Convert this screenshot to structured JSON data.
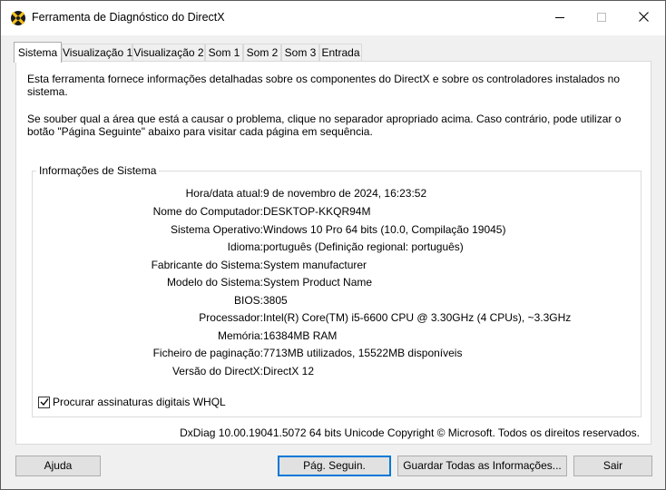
{
  "window": {
    "title": "Ferramenta de Diagnóstico do DirectX"
  },
  "tabs": [
    {
      "label": "Sistema",
      "active": true
    },
    {
      "label": "Visualização 1",
      "active": false
    },
    {
      "label": "Visualização 2",
      "active": false
    },
    {
      "label": "Som 1",
      "active": false
    },
    {
      "label": "Som 2",
      "active": false
    },
    {
      "label": "Som 3",
      "active": false
    },
    {
      "label": "Entrada",
      "active": false
    }
  ],
  "intro": {
    "line1": "Esta ferramenta fornece informações detalhadas sobre os componentes do DirectX e sobre os controladores instalados no sistema.",
    "line2": "Se souber qual a área que está a causar o problema, clique no separador apropriado acima. Caso contrário, pode utilizar o botão \"Página Seguinte\" abaixo para visitar cada página em sequência."
  },
  "system_info": {
    "group_title": "Informações de Sistema",
    "rows": [
      {
        "label": "Hora/data atual:",
        "value": "9 de novembro de 2024, 16:23:52"
      },
      {
        "label": "Nome do Computador:",
        "value": "DESKTOP-KKQR94M"
      },
      {
        "label": "Sistema Operativo:",
        "value": "Windows 10 Pro 64 bits (10.0, Compilação 19045)"
      },
      {
        "label": "Idioma:",
        "value": "português (Definição regional: português)"
      },
      {
        "label": "Fabricante do Sistema:",
        "value": "System manufacturer"
      },
      {
        "label": "Modelo do Sistema:",
        "value": "System Product Name"
      },
      {
        "label": "BIOS:",
        "value": "3805"
      },
      {
        "label": "Processador:",
        "value": "Intel(R) Core(TM) i5-6600 CPU @ 3.30GHz (4 CPUs), ~3.3GHz"
      },
      {
        "label": "Memória:",
        "value": "16384MB RAM"
      },
      {
        "label": "Ficheiro de paginação:",
        "value": "7713MB utilizados, 15522MB disponíveis"
      },
      {
        "label": "Versão do DirectX:",
        "value": "DirectX 12"
      }
    ],
    "whql_checkbox_label": "Procurar assinaturas digitais WHQL",
    "whql_checked": true
  },
  "footer_text": "DxDiag 10.00.19041.5072 64 bits Unicode Copyright © Microsoft. Todos os direitos reservados.",
  "buttons": {
    "help": "Ajuda",
    "next": "Pág. Seguin.",
    "save_all": "Guardar Todas as Informações...",
    "exit": "Sair"
  },
  "icons": {
    "app": "directx-icon",
    "minimize": "minimize-icon",
    "maximize": "maximize-icon",
    "close": "close-icon"
  },
  "colors": {
    "accent": "#0078d7",
    "window_bg": "#f0f0f0"
  }
}
